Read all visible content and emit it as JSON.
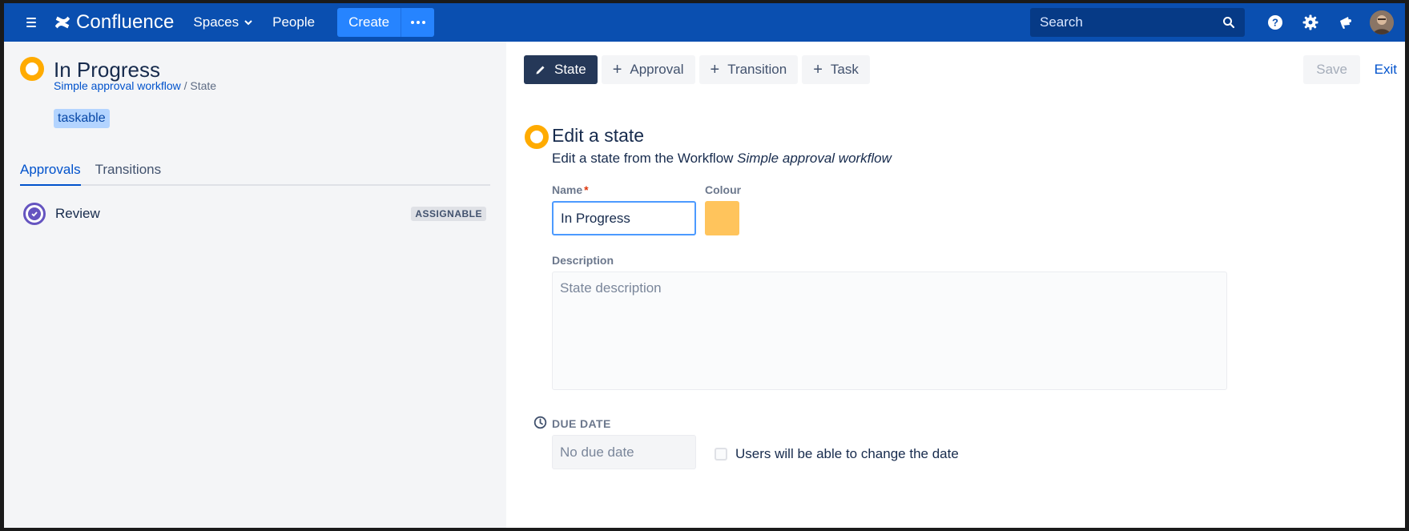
{
  "nav": {
    "logo_text": "Confluence",
    "spaces": "Spaces",
    "people": "People",
    "create": "Create",
    "search_placeholder": "Search"
  },
  "left": {
    "title": "In Progress",
    "breadcrumb_link": "Simple approval workflow",
    "breadcrumb_sep": " / ",
    "breadcrumb_current": "State",
    "tag": "taskable",
    "tabs": [
      "Approvals",
      "Transitions"
    ],
    "approvals": [
      {
        "label": "Review",
        "badge": "ASSIGNABLE"
      }
    ]
  },
  "toolbar": {
    "state": "State",
    "approval": "Approval",
    "transition": "Transition",
    "task": "Task",
    "plus": "+",
    "save": "Save",
    "exit": "Exit"
  },
  "form": {
    "title": "Edit a state",
    "subtitle_prefix": "Edit a state from the Workflow ",
    "subtitle_workflow": "Simple approval workflow",
    "name_label": "Name",
    "required_mark": "*",
    "name_value": "In Progress",
    "colour_label": "Colour",
    "colour_value": "#ffc45c",
    "description_label": "Description",
    "description_placeholder": "State description",
    "due_label": "DUE DATE",
    "due_placeholder": "No due date",
    "due_checkbox_label": "Users will be able to change the date"
  },
  "colors": {
    "nav_bg": "#0a4fb0",
    "accent": "#0052cc",
    "state_ring": "#ffab00",
    "approval_ring": "#6554c0",
    "primary_button": "#253858"
  }
}
